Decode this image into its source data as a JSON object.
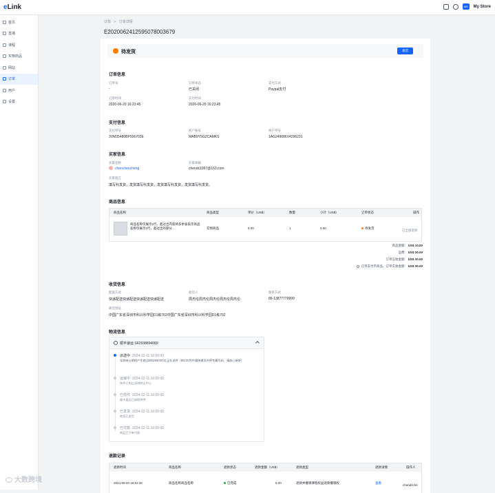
{
  "header": {
    "logo_prefix": "e",
    "logo_text": "Link",
    "avatar_text": "MS",
    "store_name": "My Store",
    "icons": [
      "store-icon",
      "globe-icon"
    ]
  },
  "sidebar": {
    "items": [
      {
        "label": "首页",
        "icon": "home-icon"
      },
      {
        "label": "直播",
        "icon": "live-icon"
      },
      {
        "label": "课程",
        "icon": "course-icon"
      },
      {
        "label": "实物商品",
        "icon": "goods-icon"
      },
      {
        "label": "网站",
        "icon": "website-icon"
      },
      {
        "label": "订单",
        "icon": "order-icon"
      },
      {
        "label": "用户",
        "icon": "user-icon"
      },
      {
        "label": "设置",
        "icon": "settings-icon"
      }
    ],
    "active_index": 5
  },
  "breadcrumb": {
    "parent": "订单",
    "sep": ">",
    "current": "订单详情"
  },
  "order_title": "E2020062412595078003679",
  "status": {
    "text": "待发货",
    "button": "发货",
    "color": "#ff7d00"
  },
  "order_info": {
    "title": "订单信息",
    "fields": [
      {
        "label": "订单号",
        "value": "-"
      },
      {
        "label": "订单状态",
        "value": "已关闭"
      },
      {
        "label": "支付方式",
        "value": "Paypal支付"
      },
      {
        "label": "订单时间",
        "value": "2020-06-20 16:23:45"
      },
      {
        "label": "支付时间",
        "value": "2020-06-20 16:23:45"
      }
    ]
  },
  "payment_info": {
    "title": "支付信息",
    "fields": [
      {
        "label": "支付单号",
        "value": "3VM35480BP506702E"
      },
      {
        "label": "商户账号",
        "value": "MAB9Y5GZCAMKS"
      },
      {
        "label": "商户单号",
        "value": "1AG249086V4296231"
      }
    ]
  },
  "buyer_info": {
    "title": "买家信息",
    "name_label": "买家名称",
    "name": "chenchencheng",
    "email_label": "买家邮箱",
    "email": "chendc1997@163.com",
    "note_label": "买家留言",
    "note": "填写代发货，发货填写代发货，发货填写代发货，发货填写代发货。"
  },
  "goods_info": {
    "title": "商品信息",
    "columns": [
      "商品名称",
      "商品类型",
      "单价（US$）",
      "数量",
      "小计（US$）",
      "订单状态",
      "操作"
    ],
    "rows": [
      {
        "name": "商品名称仅展示2行，超过出内容将多余省表示商品名称仅展示2行，超过出的部分...",
        "type": "实物商品",
        "price": "5.00",
        "qty": "1",
        "subtotal": "0.00",
        "status": "待发货",
        "status_color": "#ff7d00",
        "action": "已全部退款"
      }
    ],
    "summary": [
      {
        "label": "商品金额:",
        "value": "US$ 10.00"
      },
      {
        "label": "运费:",
        "value": "US$ 20.00"
      },
      {
        "label": "订单应收金额:",
        "value": "US$ 30.00"
      },
      {
        "label": "订单支付币商品、订单实收金额:",
        "value": "US$ 30.00",
        "bold": true
      }
    ]
  },
  "shipping_info": {
    "title": "收货信息",
    "fields": [
      {
        "label": "配送方式",
        "value": "快递配送快递配送快递配送快递配送"
      },
      {
        "label": "收货人",
        "value": "周杰伦周杰伦周杰伦周杰伦周杰伦"
      },
      {
        "label": "联系方式",
        "value": "86-13877779999"
      }
    ],
    "address_label": "收货地址",
    "address": "中国广东省深圳市科兴科学园D1栋702中国广东省深圳市科兴科学园D1栋702"
  },
  "logistics": {
    "title": "物流信息",
    "carrier": "顺丰速运",
    "tracking": "SF2938894089",
    "events": [
      {
        "status": "派送中",
        "time": "2024-12-11 10:00:00",
        "desc": "深圳市公明的产生商 [18033067873] 正在派件（95720为中通快递员外呼专属号码，请放心接听）",
        "active": true
      },
      {
        "status": "运输中",
        "time": "2024-12-11 10:00:00",
        "desc": "快件已到达深圳转运中心",
        "active": false
      },
      {
        "status": "已揽件",
        "time": "2024-12-11 10:00:00",
        "desc": "顺丰速运已收取快件",
        "active": false
      },
      {
        "status": "已发货",
        "time": "2024-12-11 10:00:00",
        "desc": "商家已发货",
        "active": false
      },
      {
        "status": "已付款",
        "time": "2024-12-11 10:00:00",
        "desc": "商品已下单付款",
        "active": false
      }
    ]
  },
  "refund": {
    "title": "退款记录",
    "columns": [
      "退款时间",
      "商品名称",
      "退款状态",
      "退款金额（US$）",
      "退款类型",
      "退款详情",
      "操作人"
    ],
    "rows": [
      {
        "time": "2024-09-20 16:52:26",
        "name": "商品名称商品名称",
        "status": "已完成",
        "status_color": "#00b42a",
        "amount": "5.00",
        "type": "退款并撤销课程权益退款撤销权",
        "detail": "查看",
        "operator": "chendzche"
      }
    ]
  },
  "watermark": "大数跨境"
}
